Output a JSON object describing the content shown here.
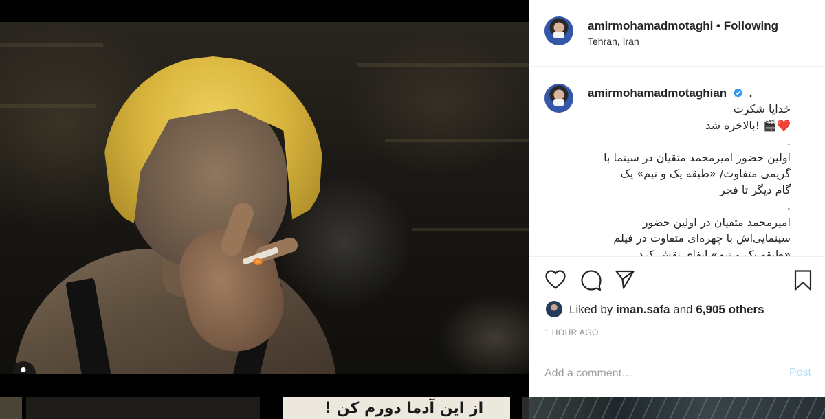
{
  "post": {
    "author": "amirmohamadmotaghi",
    "separator": "•",
    "follow_state": "Following",
    "location": "Tehran, Iran"
  },
  "caption": {
    "username": "amirmohamadmotaghian",
    "verified": true,
    "trailing": ".",
    "lines": [
      "خدایا شکرت",
      "❤️🎬 !بالاخره شد",
      ".",
      "اولین حضور امیرمحمد متقیان در سینما با",
      "گریمی متفاوت/ «طبقه یک و نیم» یک",
      "گام دیگر تا فجر",
      ".",
      "امیرمحمد متقیان در اولین حضور",
      "سینمایی‌اش با چهره‌ای متفاوت در فیلم",
      "«طبقه یک و نیم» ایفای نقش کرد."
    ]
  },
  "actions": {
    "like_icon": "heart-outline-icon",
    "comment_icon": "comment-bubble-icon",
    "share_icon": "paper-plane-icon",
    "save_icon": "bookmark-icon"
  },
  "likes": {
    "prefix": "Liked by",
    "user": "iman.safa",
    "conjunction": "and",
    "others": "6,905 others"
  },
  "timestamp": "1 HOUR AGO",
  "comment": {
    "placeholder": "Add a comment…",
    "post_label": "Post"
  },
  "media": {
    "tag_icon": "user-tag-icon",
    "strip_text": "از این آدما دورم کن !"
  },
  "colors": {
    "verified": "#3897f0",
    "post_button_disabled": "#b2dffc",
    "meta_grey": "#8e8e8e",
    "text": "#262626"
  }
}
